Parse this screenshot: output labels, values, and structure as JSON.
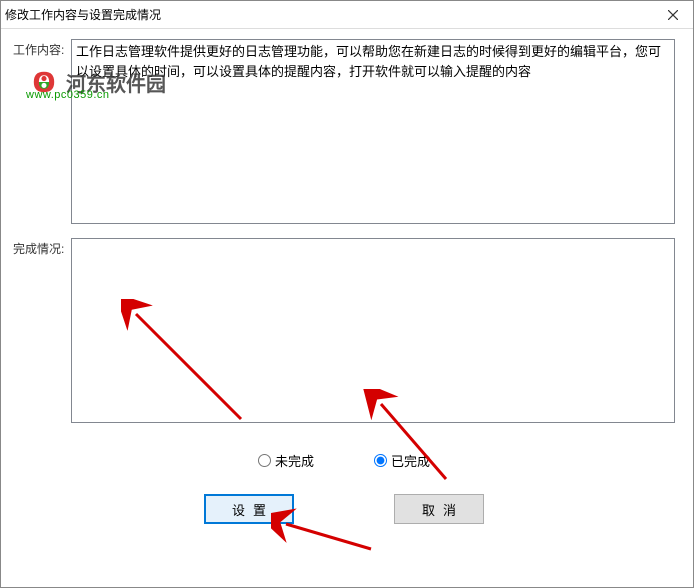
{
  "window": {
    "title": "修改工作内容与设置完成情况"
  },
  "labels": {
    "work_content": "工作内容:",
    "status": "完成情况:"
  },
  "textareas": {
    "work_content_value": "工作日志管理软件提供更好的日志管理功能，可以帮助您在新建日志的时候得到更好的编辑平台，您可以设置具体的时间，可以设置具体的提醒内容，打开软件就可以输入提醒的内容",
    "status_value": ""
  },
  "radios": {
    "incomplete": "未完成",
    "complete": "已完成",
    "selected": "complete"
  },
  "buttons": {
    "set": "设置",
    "cancel": "取消"
  },
  "watermark": {
    "brand_cn": "河东软件园",
    "url": "www.pc0359.cn"
  }
}
